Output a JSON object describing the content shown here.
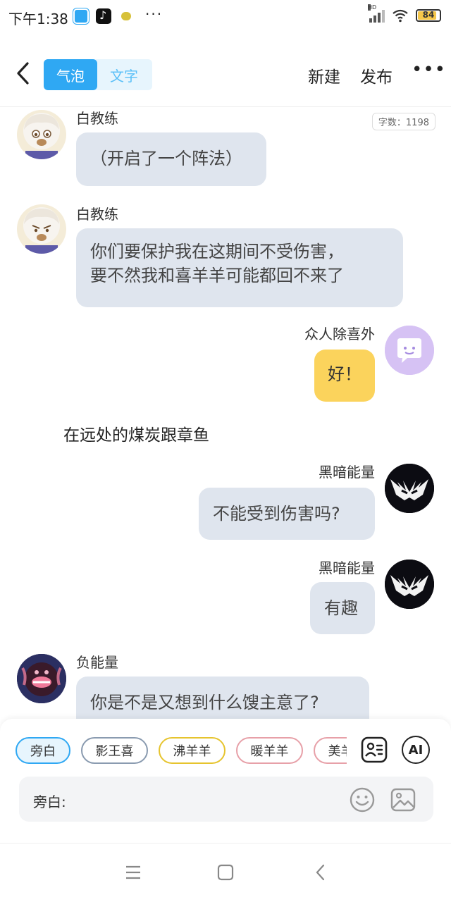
{
  "status_bar": {
    "time": "下午1:38",
    "hd_label": "HD",
    "battery": "84",
    "icons": [
      "app-blue-icon",
      "tiktok-icon",
      "app-character-icon",
      "more-dots-icon",
      "signal-icon",
      "wifi-icon",
      "battery-icon"
    ]
  },
  "header": {
    "tab_bubble": "气泡",
    "tab_text": "文字",
    "new_label": "新建",
    "publish_label": "发布",
    "more_label": "•••",
    "colors": {
      "accent": "#2fa8f3",
      "accent_light": "#e7f5fd"
    }
  },
  "chat": {
    "word_count": "字数：1198",
    "messages": [
      {
        "speaker": "白教练",
        "text": "（开启了一个阵法）",
        "side": "left"
      },
      {
        "speaker": "白教练",
        "text_line1": "你们要保护我在这期间不受伤害，",
        "text_line2": "要不然我和喜羊羊可能都回不来了",
        "side": "left"
      },
      {
        "speaker": "众人除喜外",
        "text": "好！",
        "side": "right"
      },
      {
        "narration": "在远处的煤炭跟章鱼"
      },
      {
        "speaker": "黑暗能量",
        "text": "不能受到伤害吗?",
        "side": "right"
      },
      {
        "speaker": "黑暗能量",
        "text": "有趣",
        "side": "right"
      },
      {
        "speaker": "负能量",
        "text": "你是不是又想到什么馊主意了?",
        "side": "left"
      }
    ]
  },
  "panel": {
    "chips": [
      "旁白",
      "影王喜",
      "沸羊羊",
      "暖羊羊",
      "美羊羊"
    ],
    "selected_chip": "旁白",
    "input_label": "旁白:",
    "ai_label": "AI",
    "icons": [
      "character-list-icon",
      "ai-icon",
      "emoji-icon",
      "image-icon"
    ]
  },
  "nav": {
    "icons": [
      "menu-icon",
      "home-icon",
      "back-icon"
    ]
  }
}
